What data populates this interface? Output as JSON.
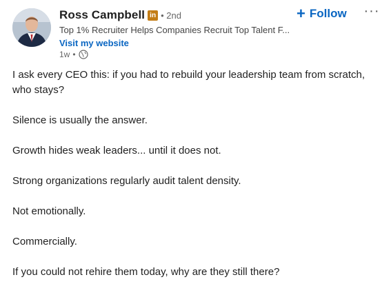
{
  "post": {
    "author": {
      "name": "Ross Campbell",
      "badge": "in",
      "degree": "• 2nd",
      "headline": "Top 1% Recruiter Helps Companies Recruit Top Talent F...",
      "website_label": "Visit my website",
      "time": "1w",
      "time_separator": "•",
      "visibility_icon": "globe-icon"
    },
    "actions": {
      "follow_icon": "+",
      "follow_label": "Follow",
      "more_label": "···"
    },
    "paragraphs": [
      "I ask every CEO this: if you had to rebuild your leadership team from scratch, who stays?",
      "Silence is usually the answer.",
      "Growth hides weak leaders... until it does not.",
      "Strong organizations regularly audit talent density.",
      "Not emotionally.",
      "Commercially.",
      "If you could not rehire them today, why are they still there?"
    ]
  },
  "colors": {
    "link": "#0a66c2",
    "text": "#1f1f1f",
    "secondary": "#666666",
    "badge": "#c37d16"
  }
}
